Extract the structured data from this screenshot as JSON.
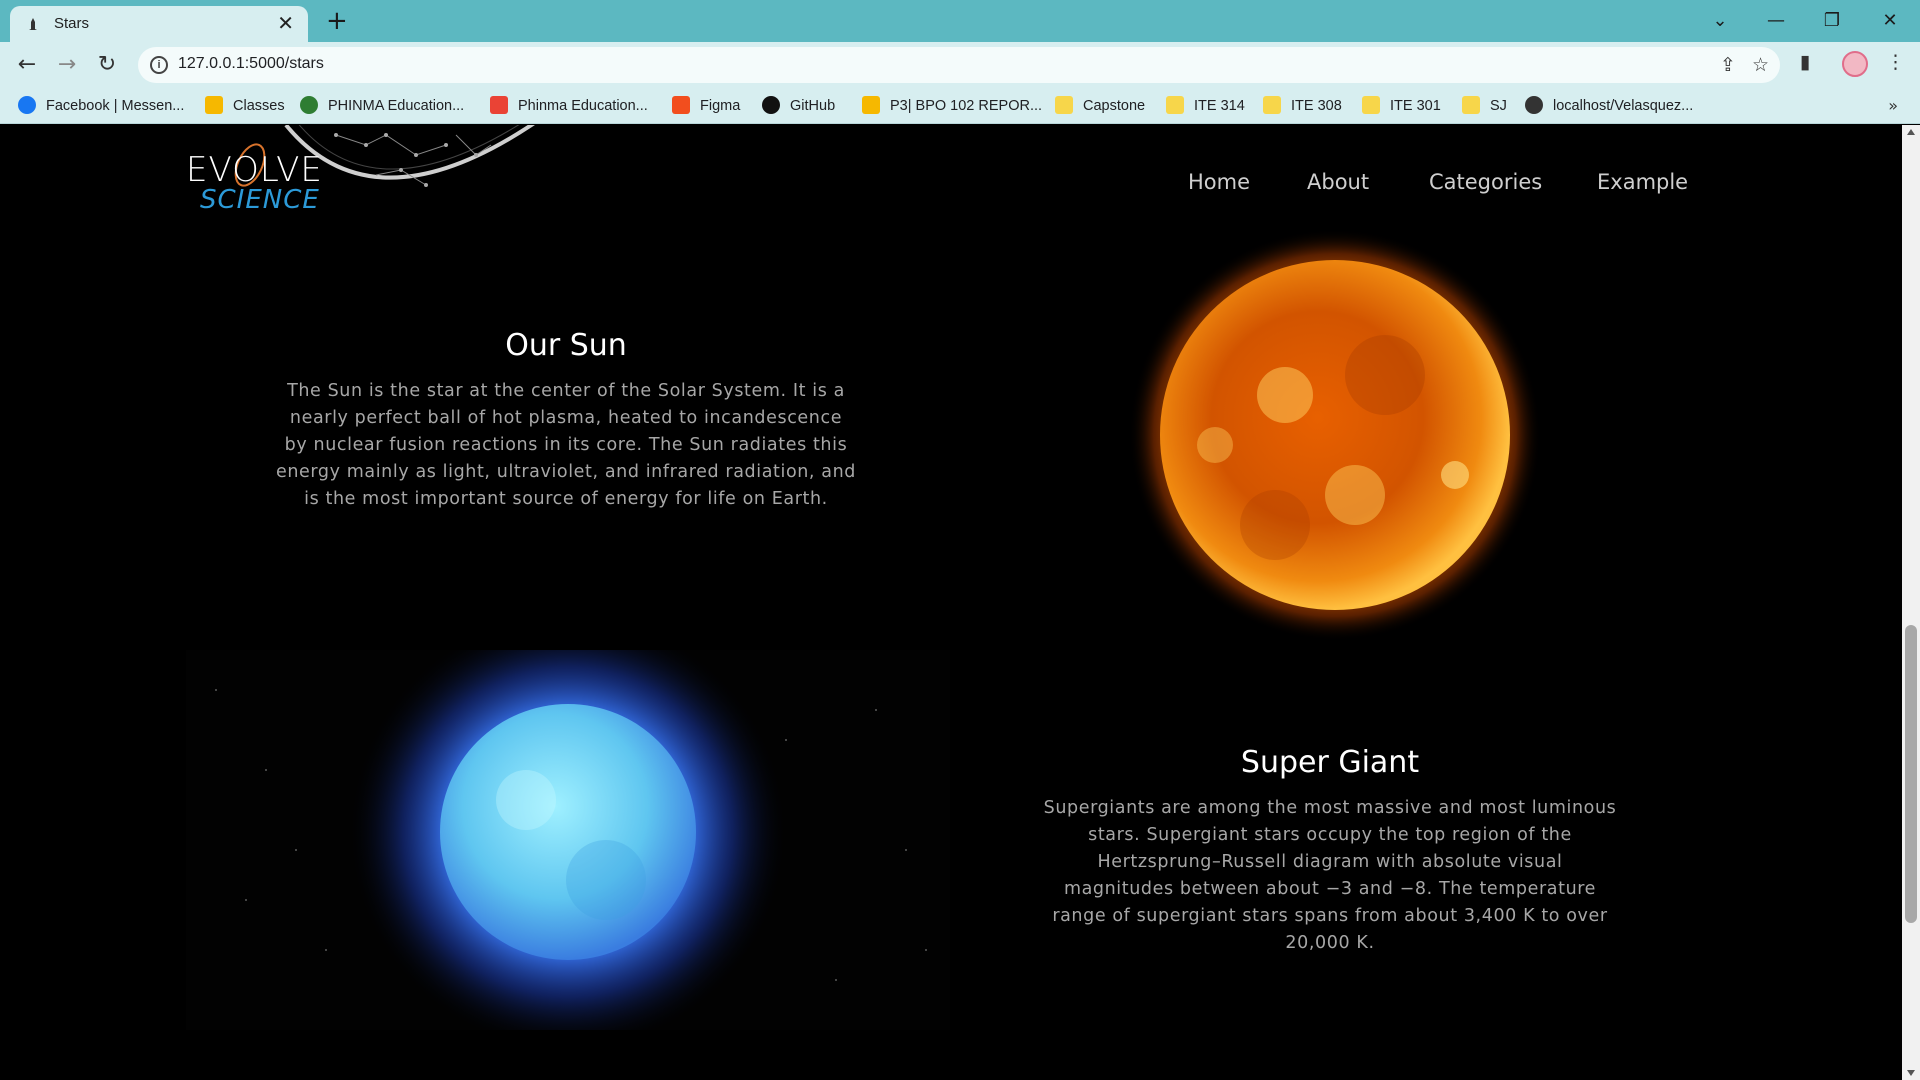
{
  "browser": {
    "tab_title": "Stars",
    "url": "127.0.0.1:5000/stars",
    "bookmarks": [
      {
        "label": "Facebook | Messen...",
        "color": "#1877f2"
      },
      {
        "label": "Classes",
        "color": "#f6b800"
      },
      {
        "label": "PHINMA Education...",
        "color": "#2e7d32"
      },
      {
        "label": "Phinma Education...",
        "color": "#ea4335"
      },
      {
        "label": "Figma",
        "color": "#f24e1e"
      },
      {
        "label": "GitHub",
        "color": "#111111"
      },
      {
        "label": "P3| BPO 102 REPOR...",
        "color": "#f6b800"
      },
      {
        "label": "Capstone",
        "color": "#f7d64a"
      },
      {
        "label": "ITE 314",
        "color": "#f7d64a"
      },
      {
        "label": "ITE 308",
        "color": "#f7d64a"
      },
      {
        "label": "ITE 301",
        "color": "#f7d64a"
      },
      {
        "label": "SJ",
        "color": "#f7d64a"
      },
      {
        "label": "localhost/Velasquez...",
        "color": "#333333"
      }
    ]
  },
  "site": {
    "logo_main": "EVOLVE",
    "logo_sub": "SCIENCE",
    "nav": [
      "Home",
      "About",
      "Categories",
      "Example"
    ]
  },
  "sections": {
    "sun": {
      "title": "Our Sun",
      "text": "The Sun is the star at the center of the Solar System. It is a nearly perfect ball of hot plasma, heated to incandescence by nuclear fusion reactions in its core. The Sun radiates this energy mainly as light, ultraviolet, and infrared radiation, and is the most important source of energy for life on Earth."
    },
    "giant": {
      "title": "Super Giant",
      "text": "Supergiants are among the most massive and most luminous stars. Supergiant stars occupy the top region of the Hertzsprung–Russell diagram with absolute visual magnitudes between about −3 and −8. The temperature range of supergiant stars spans from about 3,400 K to over 20,000 K."
    }
  },
  "colors": {
    "chrome_teal": "#5cb8c1",
    "chrome_light": "#d7eef0",
    "page_bg": "#000000"
  }
}
